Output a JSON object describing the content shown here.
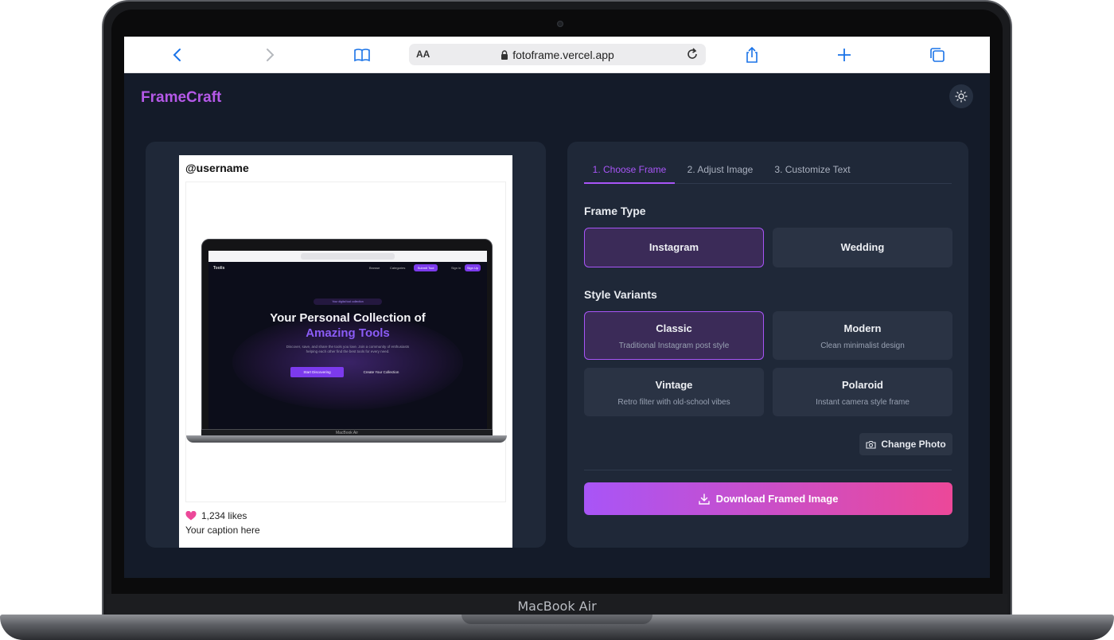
{
  "device": {
    "label": "MacBook Air"
  },
  "browser": {
    "aa_label": "AA",
    "url": "fotoframe.vercel.app"
  },
  "app": {
    "brand": "FrameCraft",
    "colors": {
      "accent": "#a855f7",
      "gradient_end": "#ec4899",
      "brand": "#b559e8",
      "bg": "#141b29",
      "card": "#1f2838"
    }
  },
  "preview": {
    "username": "@username",
    "likes": "1,234 likes",
    "caption": "Your caption here",
    "photo": {
      "brand": "Toolis",
      "nav": [
        "Browse",
        "Categories",
        "Submit Tool",
        "Sign in",
        "Sign Up"
      ],
      "badge": "Your digital tool collection",
      "headline_1": "Your Personal Collection of",
      "headline_2": "Amazing Tools",
      "subtitle": "Discover, save, and share the tools you love. Join a community of enthusiasts helping each other find the best tools for every need.",
      "btn_primary": "Start Discovering",
      "btn_secondary": "Create Your Collection",
      "device_label": "MacBook Air"
    }
  },
  "editor": {
    "tabs": [
      {
        "label": "1. Choose Frame",
        "active": true
      },
      {
        "label": "2. Adjust Image",
        "active": false
      },
      {
        "label": "3. Customize Text",
        "active": false
      }
    ],
    "frame_type": {
      "title": "Frame Type",
      "options": [
        {
          "name": "Instagram",
          "selected": true
        },
        {
          "name": "Wedding",
          "selected": false
        }
      ]
    },
    "style_variants": {
      "title": "Style Variants",
      "options": [
        {
          "name": "Classic",
          "desc": "Traditional Instagram post style",
          "selected": true
        },
        {
          "name": "Modern",
          "desc": "Clean minimalist design",
          "selected": false
        },
        {
          "name": "Vintage",
          "desc": "Retro filter with old-school vibes",
          "selected": false
        },
        {
          "name": "Polaroid",
          "desc": "Instant camera style frame",
          "selected": false
        }
      ]
    },
    "change_photo": "Change Photo",
    "download": "Download Framed Image"
  }
}
